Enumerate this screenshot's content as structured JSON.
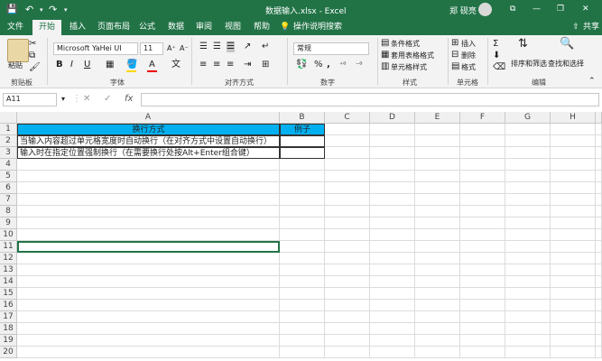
{
  "title_bar": {
    "doc_title": "数据输入.xlsx  -  Excel",
    "user": "郑 砚亮",
    "qat": {
      "save": "💾",
      "undo": "↶",
      "redo": "↷"
    },
    "window": {
      "minimize": "—",
      "restore": "❐",
      "close": "✕",
      "ribbon_opts": "⧉"
    }
  },
  "tabs": [
    "文件",
    "开始",
    "插入",
    "页面布局",
    "公式",
    "数据",
    "审阅",
    "视图",
    "帮助"
  ],
  "active_tab": "开始",
  "tell_me": "操作说明搜索",
  "share": "共享",
  "ribbon": {
    "clipboard": {
      "paste": "粘贴",
      "label": "剪贴板"
    },
    "font": {
      "name": "Microsoft YaHei UI",
      "size": "11",
      "label": "字体",
      "bold": "B",
      "italic": "I",
      "underline": "U",
      "grow": "A⁺",
      "shrink": "A⁻",
      "wen": "文"
    },
    "alignment": {
      "label": "对齐方式"
    },
    "number": {
      "format": "常规",
      "label": "数字",
      "pct": "%",
      "comma": ","
    },
    "styles": {
      "cond": "条件格式",
      "table": "套用表格格式",
      "cell": "单元格样式",
      "label": "样式"
    },
    "cells": {
      "insert": "插入",
      "delete": "删除",
      "format": "格式",
      "label": "单元格"
    },
    "editing": {
      "sort": "排序和筛选",
      "find": "查找和选择",
      "sigma": "Σ",
      "label": "编辑"
    }
  },
  "formula_bar": {
    "name_box": "A11",
    "cancel": "✕",
    "enter": "✓",
    "fx": "fx",
    "value": ""
  },
  "columns": [
    "A",
    "B",
    "C",
    "D",
    "E",
    "F",
    "G",
    "H"
  ],
  "rows": [
    "1",
    "2",
    "3",
    "4",
    "5",
    "6",
    "7",
    "8",
    "9",
    "10",
    "11",
    "12",
    "13",
    "14",
    "15",
    "16",
    "17",
    "18",
    "19",
    "20"
  ],
  "cells": {
    "A1": "换行方式",
    "B1": "例子",
    "A2": "当输入内容超过单元格宽度时自动换行（在对齐方式中设置自动换行）",
    "A3": "输入时在指定位置强制换行（在需要换行处按Alt+Enter组合键）"
  },
  "colors": {
    "excel_green": "#217346",
    "header_fill": "#00b0f0"
  }
}
